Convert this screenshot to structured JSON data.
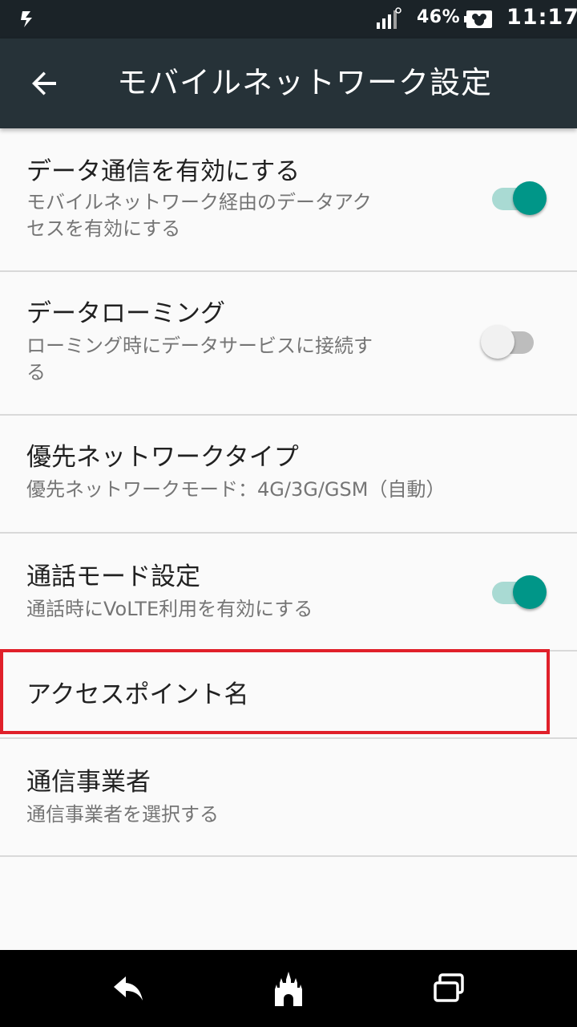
{
  "status_bar": {
    "battery_percent": "46%",
    "time": "11:17"
  },
  "app_bar": {
    "back_icon": "arrow-back-icon",
    "title": "モバイルネットワーク設定"
  },
  "settings": [
    {
      "title": "データ通信を有効にする",
      "summary_lines": [
        "モバイルネットワーク経由のデータアク",
        "セスを有効にする"
      ],
      "toggle": "on"
    },
    {
      "title": "データローミング",
      "summary_lines": [
        "ローミング時にデータサービスに接続す",
        "る"
      ],
      "toggle": "off"
    },
    {
      "title": "優先ネットワークタイプ",
      "summary_lines": [
        "優先ネットワークモード：4G/3G/GSM（自動）"
      ]
    },
    {
      "title": "通話モード設定",
      "summary_lines": [
        "通話時にVoLTE利用を有効にする"
      ],
      "toggle": "on"
    },
    {
      "title": "アクセスポイント名",
      "highlighted": true
    },
    {
      "title": "通信事業者",
      "summary_lines": [
        "通信事業者を選択する"
      ]
    }
  ],
  "colors": {
    "app_bar": "#263238",
    "status_bar": "#1b2328",
    "accent": "#009688",
    "highlight": "#e0202a"
  },
  "nav_bar": {
    "icons": [
      "back-icon",
      "castle-home-icon",
      "recent-apps-icon"
    ]
  }
}
